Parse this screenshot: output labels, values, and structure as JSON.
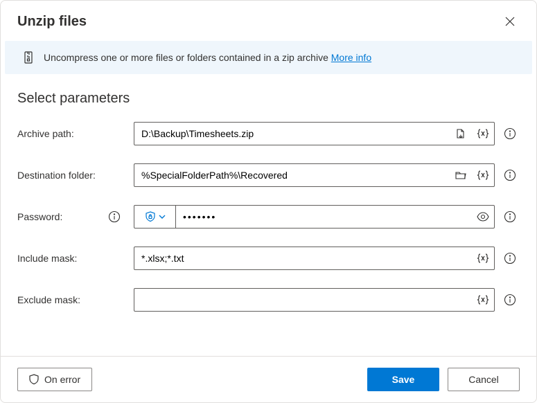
{
  "header": {
    "title": "Unzip files"
  },
  "banner": {
    "text": "Uncompress one or more files or folders contained in a zip archive ",
    "link_label": "More info"
  },
  "section": {
    "title": "Select parameters"
  },
  "fields": {
    "archive": {
      "label": "Archive path:",
      "value": "D:\\Backup\\Timesheets.zip"
    },
    "destination": {
      "label": "Destination folder:",
      "value": "%SpecialFolderPath%\\Recovered"
    },
    "password": {
      "label": "Password:",
      "value": "•••••••"
    },
    "include": {
      "label": "Include mask:",
      "value": "*.xlsx;*.txt"
    },
    "exclude": {
      "label": "Exclude mask:",
      "value": ""
    }
  },
  "footer": {
    "on_error": "On error",
    "save": "Save",
    "cancel": "Cancel"
  }
}
